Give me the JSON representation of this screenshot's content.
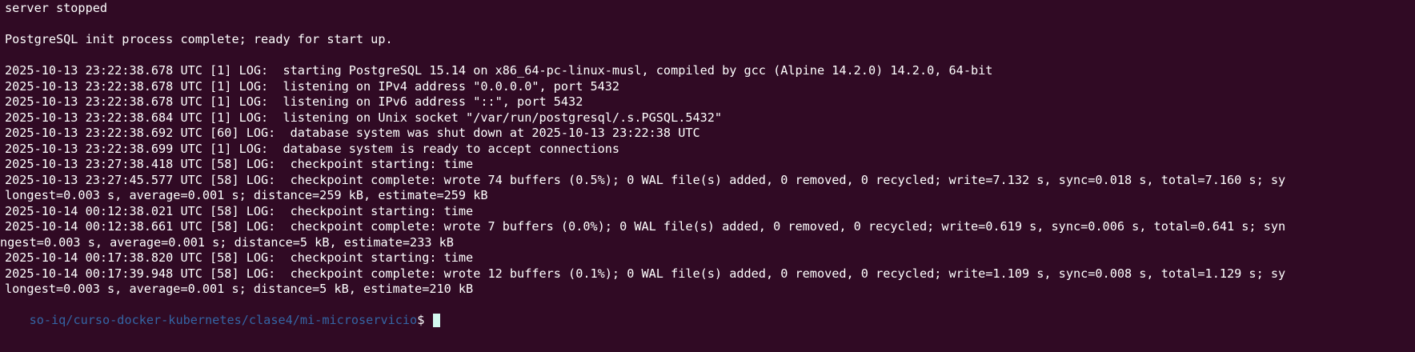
{
  "terminal": {
    "lines": [
      "server stopped",
      "",
      "PostgreSQL init process complete; ready for start up.",
      "",
      "2025-10-13 23:22:38.678 UTC [1] LOG:  starting PostgreSQL 15.14 on x86_64-pc-linux-musl, compiled by gcc (Alpine 14.2.0) 14.2.0, 64-bit",
      "2025-10-13 23:22:38.678 UTC [1] LOG:  listening on IPv4 address \"0.0.0.0\", port 5432",
      "2025-10-13 23:22:38.678 UTC [1] LOG:  listening on IPv6 address \"::\", port 5432",
      "2025-10-13 23:22:38.684 UTC [1] LOG:  listening on Unix socket \"/var/run/postgresql/.s.PGSQL.5432\"",
      "2025-10-13 23:22:38.692 UTC [60] LOG:  database system was shut down at 2025-10-13 23:22:38 UTC",
      "2025-10-13 23:22:38.699 UTC [1] LOG:  database system is ready to accept connections",
      "2025-10-13 23:27:38.418 UTC [58] LOG:  checkpoint starting: time",
      "2025-10-13 23:27:45.577 UTC [58] LOG:  checkpoint complete: wrote 74 buffers (0.5%); 0 WAL file(s) added, 0 removed, 0 recycled; write=7.132 s, sync=0.018 s, total=7.160 s; sy",
      "longest=0.003 s, average=0.001 s; distance=259 kB, estimate=259 kB",
      "2025-10-14 00:12:38.021 UTC [58] LOG:  checkpoint starting: time",
      "2025-10-14 00:12:38.661 UTC [58] LOG:  checkpoint complete: wrote 7 buffers (0.0%); 0 WAL file(s) added, 0 removed, 0 recycled; write=0.619 s, sync=0.006 s, total=0.641 s; syn",
      "ngest=0.003 s, average=0.001 s; distance=5 kB, estimate=233 kB",
      "2025-10-14 00:17:38.820 UTC [58] LOG:  checkpoint starting: time",
      "2025-10-14 00:17:39.948 UTC [58] LOG:  checkpoint complete: wrote 12 buffers (0.1%); 0 WAL file(s) added, 0 removed, 0 recycled; write=1.109 s, sync=0.008 s, total=1.129 s; sy",
      "longest=0.003 s, average=0.001 s; distance=5 kB, estimate=210 kB"
    ],
    "prompt": {
      "path": "so-iq/curso-docker-kubernetes/clase4/mi-microservicio",
      "symbol": "$ "
    }
  },
  "colors": {
    "background": "#300a24",
    "text": "#ffffff",
    "prompt_path": "#3465a4",
    "cursor": "#d3f9f0"
  }
}
